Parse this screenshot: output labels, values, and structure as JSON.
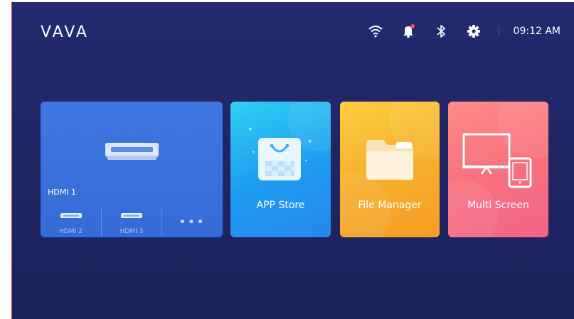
{
  "brand": {
    "logo_text": "VAVA"
  },
  "status": {
    "time": "09:12 AM",
    "icons": [
      "wifi-icon",
      "notification-bell-icon",
      "bluetooth-icon",
      "settings-gear-icon"
    ],
    "notification_dot_color": "#ff4b4b"
  },
  "tiles": {
    "hdmi": {
      "label": "HDMI 1",
      "sub_inputs": [
        {
          "label": "HDMI 2"
        },
        {
          "label": "HDMI 3"
        }
      ],
      "more_label": "•••",
      "color": "#3f76df"
    },
    "app_store": {
      "label": "APP Store",
      "color": "#1e9bf0"
    },
    "file_manager": {
      "label": "File Manager",
      "color": "#f7ad2b"
    },
    "multi_screen": {
      "label": "Multi Screen",
      "color": "#f7707f"
    }
  }
}
